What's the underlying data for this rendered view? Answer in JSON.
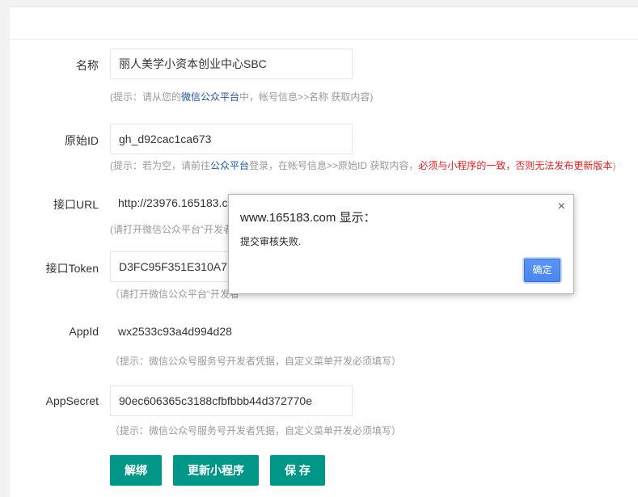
{
  "form": {
    "name": {
      "label": "名称",
      "value": "丽人美学小资本创业中心SBC",
      "hint_pre": "(提示：请从您的",
      "hint_link": "微信公众平台",
      "hint_post": "中，帐号信息>>名称 获取内容)"
    },
    "original_id": {
      "label": "原始ID",
      "value": "gh_d92cac1ca673",
      "hint_pre": "(提示：若为空，请前往",
      "hint_link": "公众平台",
      "hint_mid": "登录，在帐号信息>>原始ID 获取内容，",
      "hint_warn": "必须与小程序的一致，否则无法发布更新版本",
      "hint_post": ")"
    },
    "api_url": {
      "label": "接口URL",
      "value": "http://23976.165183.c",
      "hint": "(请打开微信公众平台“开发者"
    },
    "api_token": {
      "label": "接口Token",
      "value": "D3FC95F351E310A7",
      "hint": "（请打开微信公众平台“开发者"
    },
    "appid": {
      "label": "AppId",
      "value": "wx2533c93a4d994d28",
      "hint": "（提示：微信公众号服务号开发者凭据，自定义菜单开发必须填写）"
    },
    "appsecret": {
      "label": "AppSecret",
      "value": "90ec606365c3188cfbfbbb44d372770e",
      "hint": "（提示：微信公众号服务号开发者凭据，自定义菜单开发必须填写）"
    }
  },
  "buttons": {
    "unbind": "解绑",
    "update": "更新小程序",
    "save": "保 存"
  },
  "dialog": {
    "title": "www.165183.com 显示：",
    "message": "提交审核失败.",
    "ok": "确定",
    "close": "×"
  },
  "colors": {
    "primary": "#009688",
    "link": "#1e50a2",
    "warning": "#e01f1f"
  }
}
